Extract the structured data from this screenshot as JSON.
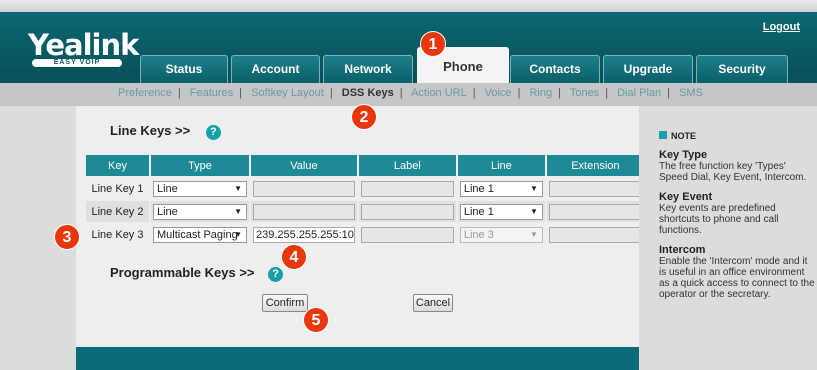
{
  "header": {
    "logo": "Yealink",
    "logo_tag": "EASY VOIP",
    "logout": "Logout"
  },
  "tabs": [
    "Status",
    "Account",
    "Network",
    "Phone",
    "Contacts",
    "Upgrade",
    "Security"
  ],
  "active_tab": "Phone",
  "subnav": [
    "Preference",
    "Features",
    "Softkey Layout",
    "DSS Keys",
    "Action URL",
    "Voice",
    "Ring",
    "Tones",
    "Dial Plan",
    "SMS"
  ],
  "active_subnav": "DSS Keys",
  "line_keys": {
    "title": "Line Keys >>",
    "help_icon": "help-icon",
    "columns": [
      "Key",
      "Type",
      "Value",
      "Label",
      "Line",
      "Extension"
    ],
    "rows": [
      {
        "key": "Line Key 1",
        "type": "Line",
        "value": "",
        "label": "",
        "line": "Line 1",
        "extension": ""
      },
      {
        "key": "Line Key 2",
        "type": "Line",
        "value": "",
        "label": "",
        "line": "Line 1",
        "extension": ""
      },
      {
        "key": "Line Key 3",
        "type": "Multicast Paging",
        "value": "239.255.255.255:10",
        "label": "",
        "line": "Line 3",
        "extension": ""
      }
    ]
  },
  "programmable_keys": {
    "title": "Programmable Keys >>"
  },
  "buttons": {
    "confirm": "Confirm",
    "cancel": "Cancel"
  },
  "note": {
    "heading": "NOTE",
    "items": [
      {
        "term": "Key Type",
        "desc": "The free function key 'Types' Speed Dial, Key Event, Intercom."
      },
      {
        "term": "Key Event",
        "desc": "Key events are predefined shortcuts to phone and call functions."
      },
      {
        "term": "Intercom",
        "desc": "Enable the 'Intercom' mode and it is useful in an office environment as a quick access to connect to the operator or the secretary."
      }
    ]
  },
  "callouts": [
    "1",
    "2",
    "3",
    "4",
    "5"
  ],
  "colors": {
    "brand": "#0b6b76",
    "callout": "#e8360d",
    "table_header": "#1e8a96"
  }
}
